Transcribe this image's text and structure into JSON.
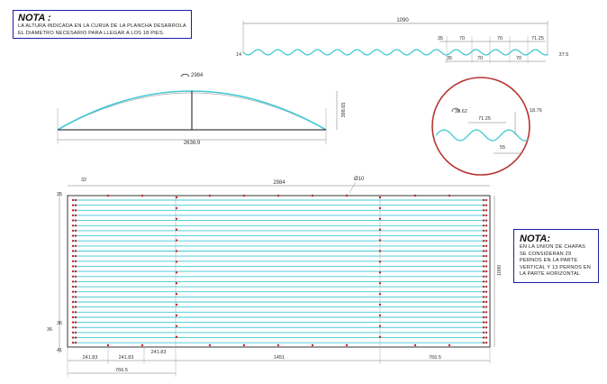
{
  "notes": {
    "top": {
      "title": "NOTA :",
      "text": "LA ALTURA INDICADA EN LA CURVA DE LA PLANCHA DESARROLA EL DIAMETRO NECESARIO PARA LLEGAR A LOS 18 PIES."
    },
    "side": {
      "title": "NOTA:",
      "text": "EN LA UNION DE CHAPAS SE CONSIDERAN 29 PERNOS EN LA PARTE VERTICAL Y 13 PERNOS EN LA PARTE HORIZONTAL"
    }
  },
  "profile": {
    "total": "1090",
    "left_edge": "14",
    "dims_top": [
      "35",
      "70",
      "70",
      "71.25"
    ],
    "dims_bottom": [
      "35",
      "70",
      "70",
      "37.5"
    ]
  },
  "arc": {
    "arc_length": "2984",
    "height": "398.65",
    "chord": "2636.9"
  },
  "detail": {
    "radius": "38.62",
    "pitch": "71.25",
    "depth": "18.76",
    "width": "55"
  },
  "plan": {
    "top_offset": "32",
    "length": "2984",
    "hole": "Ø10",
    "left_top": "25",
    "left_a": "36",
    "left_b": "36",
    "left_c": "41",
    "height": "1090",
    "bottom_dims": [
      "241.83",
      "241.83",
      "241.83"
    ],
    "bottom_mid": "1451",
    "bottom_right": "766.5",
    "bottom_left": "766.5"
  },
  "colors": {
    "cyan": "#3fc9d6",
    "red_dot": "#c0262c",
    "circle": "#b8322f",
    "note_border": "#1c1ca8"
  }
}
